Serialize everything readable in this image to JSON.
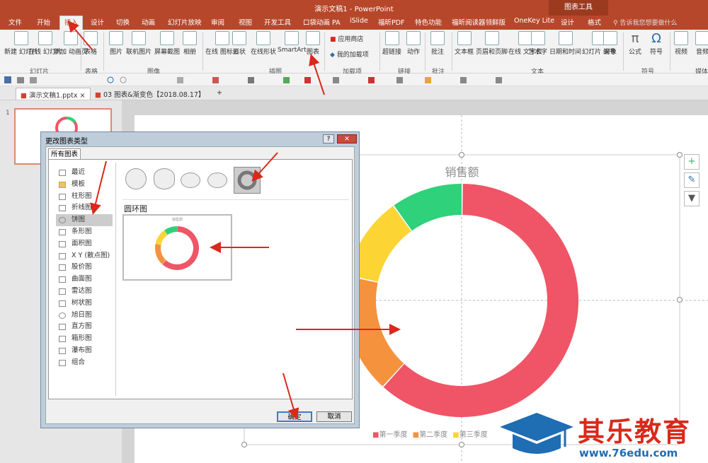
{
  "window": {
    "title": "演示文稿1 - PowerPoint",
    "tool_context": "图表工具"
  },
  "tabs": [
    {
      "label": "文件"
    },
    {
      "label": "开始"
    },
    {
      "label": "插入"
    },
    {
      "label": "设计"
    },
    {
      "label": "切换"
    },
    {
      "label": "动画"
    },
    {
      "label": "幻灯片放映"
    },
    {
      "label": "审阅"
    },
    {
      "label": "视图"
    },
    {
      "label": "开发工具"
    },
    {
      "label": "口袋动画 PA"
    },
    {
      "label": "iSlide"
    },
    {
      "label": "福昕PDF"
    },
    {
      "label": "特色功能"
    },
    {
      "label": "福昕阅读器领鲜版"
    },
    {
      "label": "OneKey Lite"
    },
    {
      "label": "设计"
    },
    {
      "label": "格式"
    }
  ],
  "tellme": "告诉我您想要做什么",
  "ribbon": {
    "buttons": [
      {
        "label": "新建\n幻灯片"
      },
      {
        "label": "在线\n幻灯片"
      },
      {
        "label": "新加\n动画页"
      },
      {
        "label": "表格"
      },
      {
        "label": "图片"
      },
      {
        "label": "联机图片"
      },
      {
        "label": "屏幕截图"
      },
      {
        "label": "相册"
      },
      {
        "label": "在线\n图标云"
      },
      {
        "label": "形状"
      },
      {
        "label": "在线形状"
      },
      {
        "label": "SmartArt"
      },
      {
        "label": "图表"
      },
      {
        "label": "应用商店"
      },
      {
        "label": "我的加载项"
      },
      {
        "label": "超链接"
      },
      {
        "label": "动作"
      },
      {
        "label": "批注"
      },
      {
        "label": "文本框"
      },
      {
        "label": "页眉和页脚"
      },
      {
        "label": "在线\n文字云"
      },
      {
        "label": "艺术字"
      },
      {
        "label": "日期和时间"
      },
      {
        "label": "幻灯片\n编号"
      },
      {
        "label": "对象"
      },
      {
        "label": "公式"
      },
      {
        "label": "符号"
      },
      {
        "label": "视频"
      },
      {
        "label": "音频"
      }
    ],
    "groups": [
      {
        "label": "幻灯片"
      },
      {
        "label": "表格"
      },
      {
        "label": "图像"
      },
      {
        "label": "插图"
      },
      {
        "label": "加载项"
      },
      {
        "label": "链接"
      },
      {
        "label": "批注"
      },
      {
        "label": "文本"
      },
      {
        "label": "符号"
      },
      {
        "label": "媒体"
      }
    ]
  },
  "doc_tabs": [
    {
      "label": "演示文稿1.pptx"
    },
    {
      "label": "03 图表&渐变色【2018.08.17】"
    },
    {
      "label": "+"
    }
  ],
  "slide_number": "1",
  "chart": {
    "title": "销售额",
    "colors": {
      "q1": "#ef5566",
      "q2": "#f5923e",
      "q3": "#fcd535",
      "q4": "#2fd17a"
    },
    "legend": [
      "第一季度",
      "第二季度",
      "第三季度"
    ]
  },
  "dialog": {
    "title": "更改图表类型",
    "help": "?",
    "close": "✕",
    "tab": "所有图表",
    "chart_types": [
      {
        "label": "最近"
      },
      {
        "label": "模板"
      },
      {
        "label": "柱形图"
      },
      {
        "label": "折线图"
      },
      {
        "label": "饼图"
      },
      {
        "label": "条形图"
      },
      {
        "label": "面积图"
      },
      {
        "label": "X Y (散点图)"
      },
      {
        "label": "股价图"
      },
      {
        "label": "曲面图"
      },
      {
        "label": "雷达图"
      },
      {
        "label": "树状图"
      },
      {
        "label": "旭日图"
      },
      {
        "label": "直方图"
      },
      {
        "label": "箱形图"
      },
      {
        "label": "瀑布图"
      },
      {
        "label": "组合"
      }
    ],
    "selected_subtype": "圆环图",
    "preview_title": "销售额",
    "ok": "确定",
    "cancel": "取消"
  },
  "watermark": {
    "title": "其乐教育",
    "url": "www.76edu.com"
  }
}
